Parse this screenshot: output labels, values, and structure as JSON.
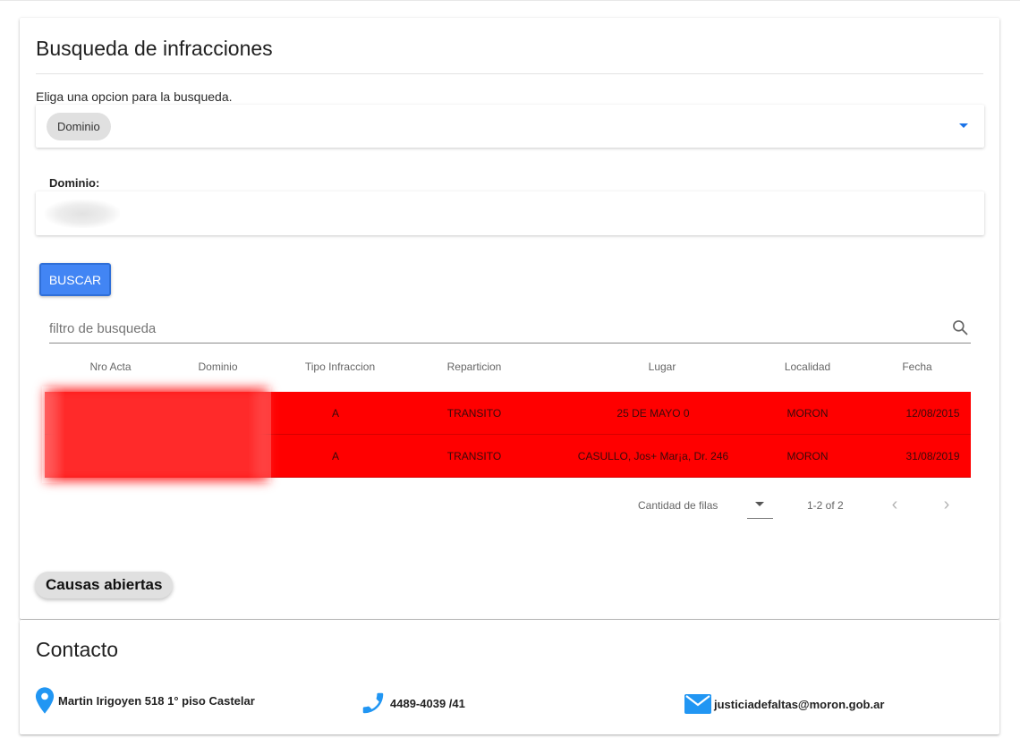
{
  "search": {
    "title": "Busqueda de infracciones",
    "option_label": "Eliga una opcion para la busqueda.",
    "selected_option": "Dominio",
    "dominio_label": "Dominio:",
    "dominio_value": "",
    "buscar_label": "BUSCAR",
    "filter_placeholder": "filtro de busqueda"
  },
  "table": {
    "columns": [
      "Nro Acta",
      "Dominio",
      "Tipo Infraccion",
      "Reparticion",
      "Lugar",
      "Localidad",
      "Fecha"
    ],
    "rows": [
      {
        "nro_acta": "",
        "dominio": "",
        "tipo": "A",
        "reparticion": "TRANSITO",
        "lugar": "25 DE MAYO 0",
        "localidad": "MORON",
        "fecha": "12/08/2015"
      },
      {
        "nro_acta": "",
        "dominio": "",
        "tipo": "A",
        "reparticion": "TRANSITO",
        "lugar": "CASULLO, Jos+ Mar¡a, Dr. 246",
        "localidad": "MORON",
        "fecha": "31/08/2019"
      }
    ],
    "row_color": "#ff0000"
  },
  "pagination": {
    "rows_label": "Cantidad de filas",
    "range": "1-2 of 2",
    "prev_icon": "chevron-left-icon",
    "next_icon": "chevron-right-icon"
  },
  "causas_label": "Causas abiertas",
  "contact": {
    "title": "Contacto",
    "address": "Martin Irigoyen 518 1° piso Castelar",
    "phone": "4489-4039 /41",
    "email": "justiciadefaltas@moron.gob.ar",
    "icon_color": "#2196f3"
  },
  "colors": {
    "accent": "#4285f4",
    "row_red": "#ff0000"
  }
}
